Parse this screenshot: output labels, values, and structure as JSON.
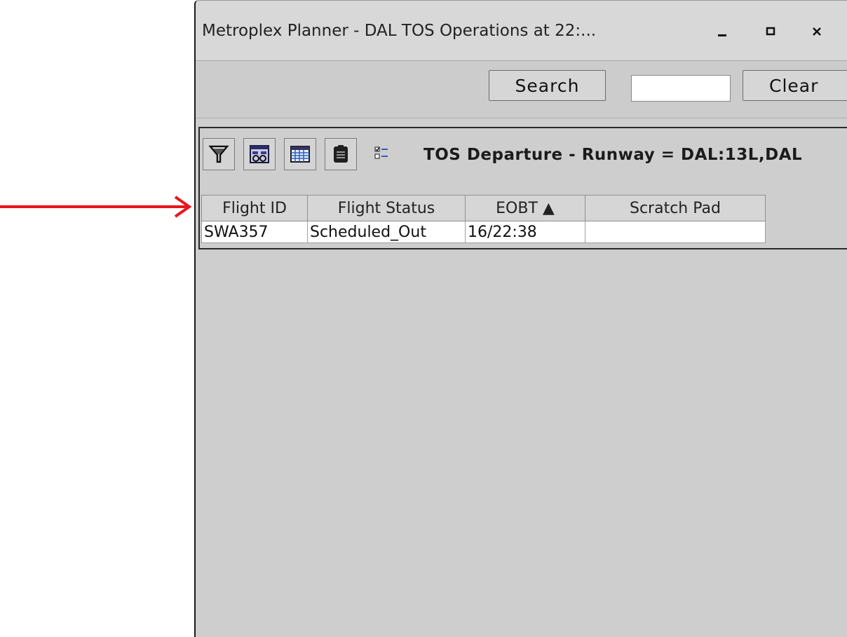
{
  "window": {
    "title": "Metroplex Planner - DAL TOS Operations at 22:...",
    "minimize": "–",
    "maximize": "□",
    "close": "×"
  },
  "toolbar": {
    "search_label": "Search",
    "search_value": "",
    "clear_label": "Clear"
  },
  "panel": {
    "icons": [
      "filter-icon",
      "flight-view-icon",
      "table-grid-icon",
      "clipboard-icon",
      "checklist-icon"
    ],
    "title": "TOS Departure - Runway =  DAL:13L,DAL"
  },
  "table": {
    "columns": [
      "Flight ID",
      "Flight Status",
      "EOBT ▲",
      "Scratch Pad"
    ],
    "rows": [
      [
        "SWA357",
        "Scheduled_Out",
        "16/22:38",
        ""
      ]
    ]
  },
  "colors": {
    "arrow": "#e8141c",
    "window_bg": "#cecece",
    "titlebar_bg": "#d8d8d8"
  }
}
